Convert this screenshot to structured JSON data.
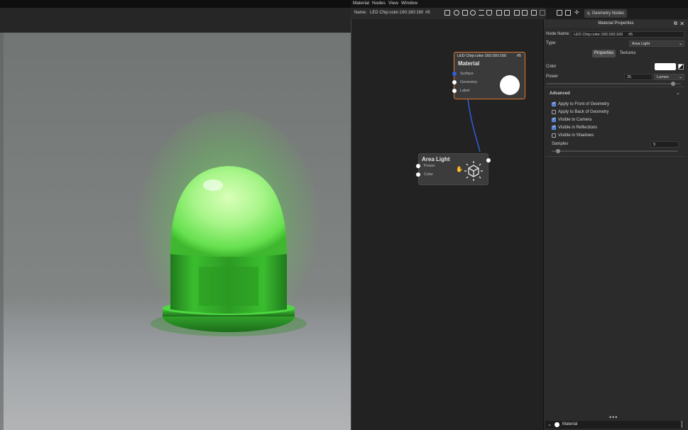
{
  "menu": {
    "items": [
      "Material",
      "Nodes",
      "View",
      "Window"
    ]
  },
  "toolbar": {
    "name_label": "Name:",
    "name_value": "LED Chip:color:160:160:160",
    "name_id": "#5",
    "geometry_nodes_label": "Geometry Nodes"
  },
  "nodes": {
    "material": {
      "header": "LED Chip:color:160:160:160",
      "header_id": "#5",
      "title": "Material",
      "inputs": [
        "Surface",
        "Geometry",
        "Label"
      ],
      "preview_color": "#ffffff",
      "border_color": "#e07a2e"
    },
    "area_light": {
      "title": "Area Light",
      "inputs": [
        "Power",
        "Color"
      ],
      "icon": "area-light-cube-icon"
    },
    "link_color": "#2f5fd6"
  },
  "properties": {
    "panel_title": "Material Properties",
    "node_name_label": "Node Name:",
    "node_name_value": "LED Chip:color:160:160:160",
    "node_name_id": "#5",
    "type_label": "Type:",
    "type_value": "Area Light",
    "tabs": [
      "Properties",
      "Textures"
    ],
    "color_label": "Color",
    "color_value": "#ffffff",
    "power_label": "Power",
    "power_value": "25",
    "power_unit": "Lumen",
    "power_slider_level": 0.94,
    "advanced_label": "Advanced",
    "checkboxes": [
      {
        "label": "Apply to Front of Geometry",
        "checked": true
      },
      {
        "label": "Apply to Back of Geometry",
        "checked": false
      },
      {
        "label": "Visible to Camera",
        "checked": true
      },
      {
        "label": "Visible in Reflections",
        "checked": true
      },
      {
        "label": "Visible in Shadows",
        "checked": false
      }
    ],
    "samples_label": "Samples",
    "samples_value": "9",
    "samples_slider_level": 0.05
  },
  "bottom": {
    "material_label": "Material"
  },
  "colors": {
    "accent": "#4a78d0",
    "led_green": "#3fd43a",
    "orange_border": "#e07a2e"
  }
}
